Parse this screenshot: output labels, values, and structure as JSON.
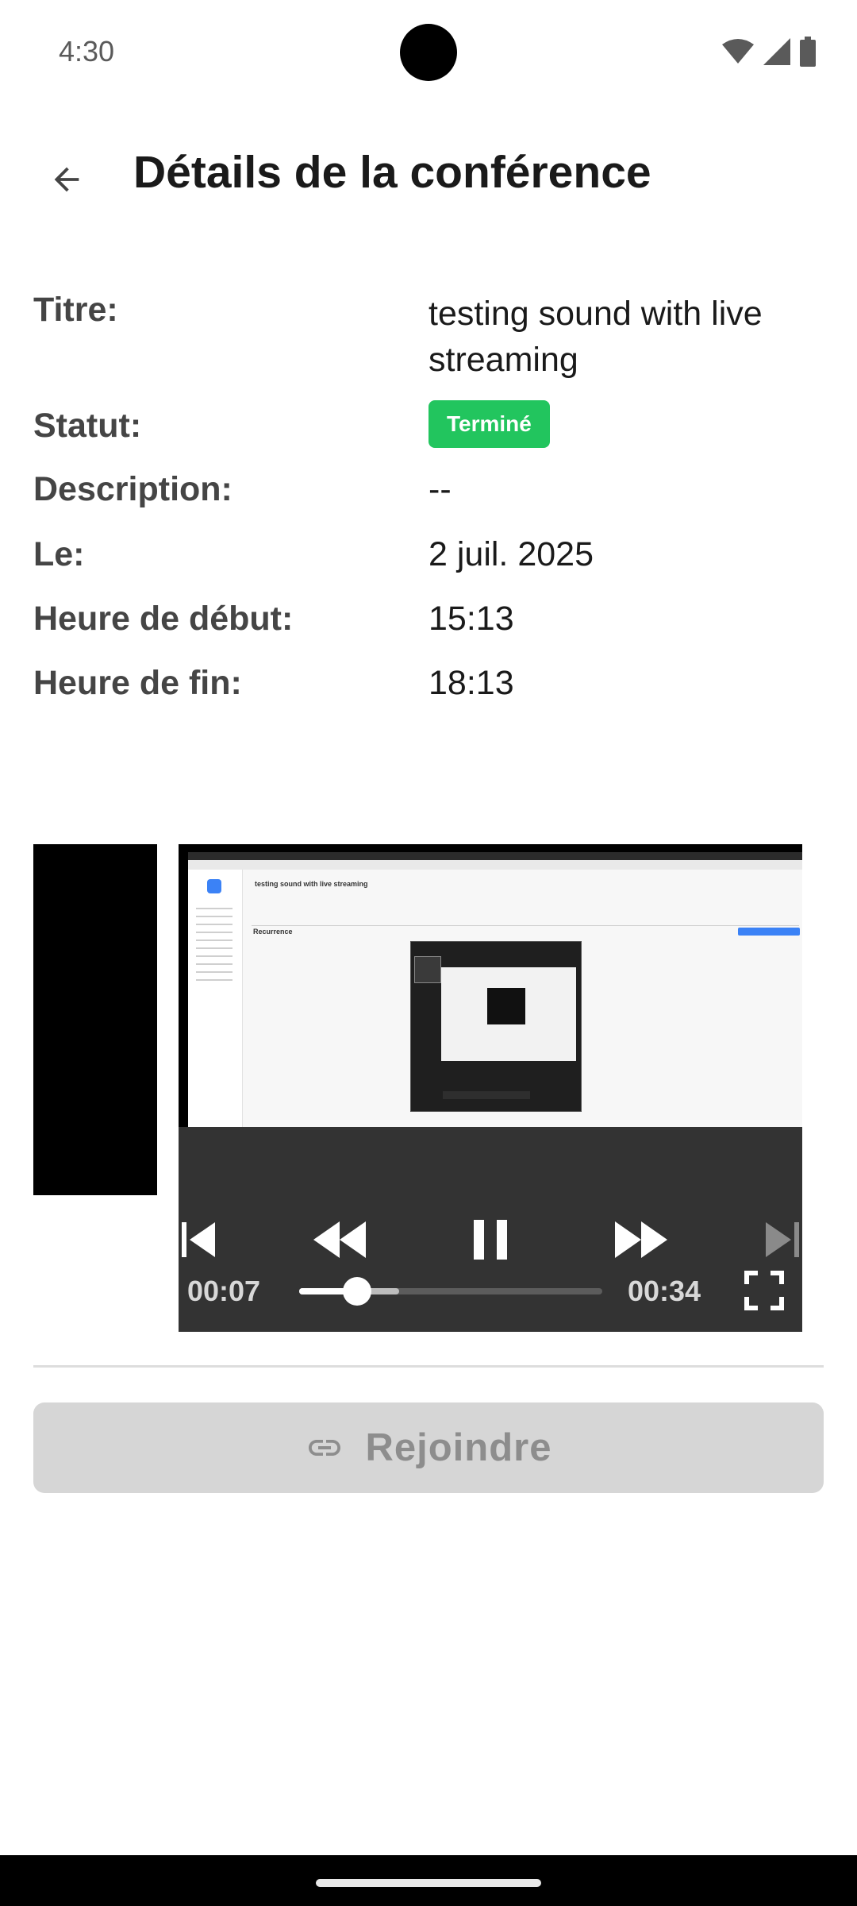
{
  "status_bar": {
    "time": "4:30",
    "icons": [
      "wifi-icon",
      "signal-icon",
      "battery-icon"
    ]
  },
  "app_bar": {
    "title": "Détails de la conférence",
    "back_icon": "arrow-back-icon"
  },
  "details": {
    "title": {
      "label": "Titre:",
      "value": "testing sound with live streaming"
    },
    "status": {
      "label": "Statut:",
      "value": "Terminé",
      "color": "#22c55e"
    },
    "description": {
      "label": "Description:",
      "value": "--"
    },
    "date": {
      "label": "Le:",
      "value": "2 juil. 2025"
    },
    "start": {
      "label": "Heure de début:",
      "value": "15:13"
    },
    "end": {
      "label": "Heure de fin:",
      "value": "18:13"
    }
  },
  "player": {
    "current_time": "00:07",
    "total_time": "00:34",
    "progress": 0.19,
    "buffered": 0.33,
    "state": "playing",
    "controls": [
      "skip-previous-icon",
      "rewind-icon",
      "pause-icon",
      "fast-forward-icon",
      "skip-next-icon",
      "fullscreen-icon"
    ],
    "video_frame": {
      "page_title": "testing sound with live streaming",
      "section": "Recurrence"
    }
  },
  "join_button": {
    "label": "Rejoindre",
    "icon": "link-icon",
    "enabled": false
  }
}
